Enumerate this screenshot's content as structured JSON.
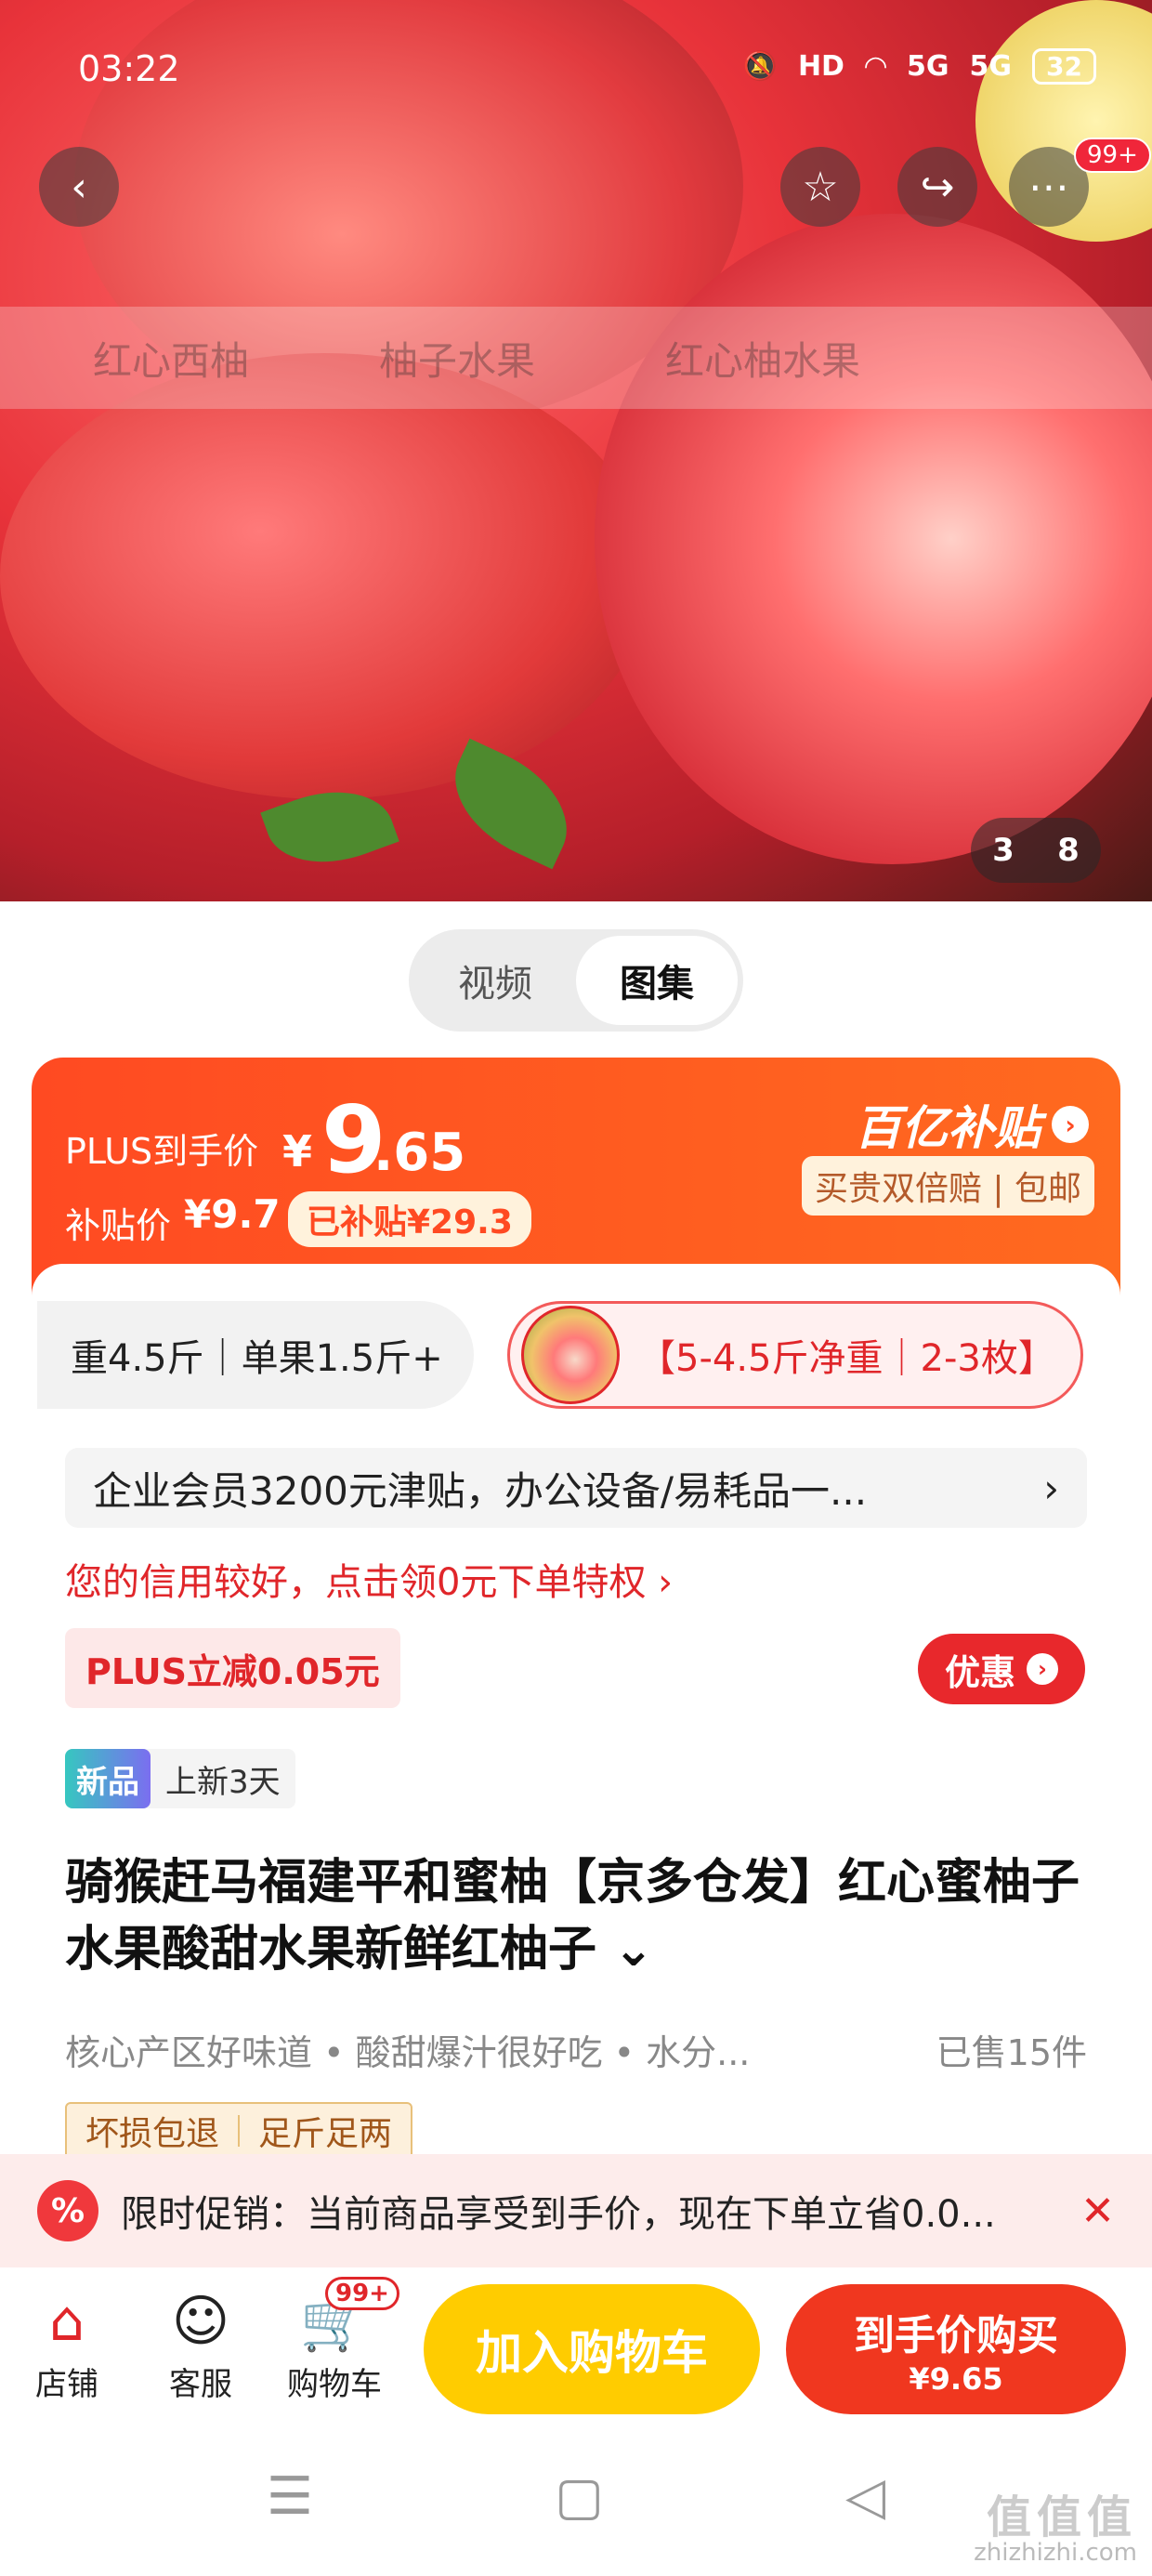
{
  "status_bar": {
    "time": "03:22",
    "network": "5G",
    "hd": "HD",
    "battery": "32"
  },
  "hero": {
    "image_counter_current": "3",
    "image_counter_total": "8",
    "more_badge": "99+",
    "search_ghost": [
      "红心西柚",
      "柚子水果",
      "红心柚水果"
    ]
  },
  "media_tabs": [
    {
      "label": "视频",
      "active": false
    },
    {
      "label": "图集",
      "active": true
    }
  ],
  "price": {
    "plus_label": "PLUS到手价",
    "currency": "¥",
    "integer": "9",
    "decimal": ".65",
    "subsidy_label": "补贴价",
    "subsidy_value": "¥9.7",
    "subsidized_pill": "已补贴¥29.3",
    "brand_text": "百亿补贴",
    "brand_tagline": "买贵双倍赔 | 包邮",
    "accent": "#ff4a22"
  },
  "specs": {
    "spec_a": "重4.5斤｜单果1.5斤+",
    "spec_b": "【5-4.5斤净重｜2-3枚】"
  },
  "promo_row": {
    "text": "企业会员3200元津贴，办公设备/易耗品一...",
    "chevron": "›"
  },
  "credit_link": "您的信用较好，点击领0元下单特权 ›",
  "plus_discount": "PLUS立减0.05元",
  "coupon_button": "优惠",
  "new_badge": {
    "tag": "新品",
    "text": "上新3天"
  },
  "product_title": "骑猴赶马福建平和蜜柚【京多仓发】红心蜜柚子水果酸甜水果新鲜红柚子 ⌄",
  "features": "核心产区好味道 • 酸甜爆汁很好吃 • 水分...",
  "sold": "已售15件",
  "guarantees": [
    "坏损包退",
    "足斤足两"
  ],
  "limited_banner": {
    "icon": "%",
    "text": "限时促销：当前商品享受到手价，现在下单立省0.0...",
    "close": "✕"
  },
  "bottom_bar": {
    "store": "店铺",
    "service": "客服",
    "cart": "购物车",
    "cart_badge": "99+",
    "add_to_cart": "加入购物车",
    "buy_now": "到手价购买",
    "buy_now_price": "¥9.65"
  },
  "watermark": {
    "main": "值值值",
    "sub": "zhizhizhi.com"
  }
}
